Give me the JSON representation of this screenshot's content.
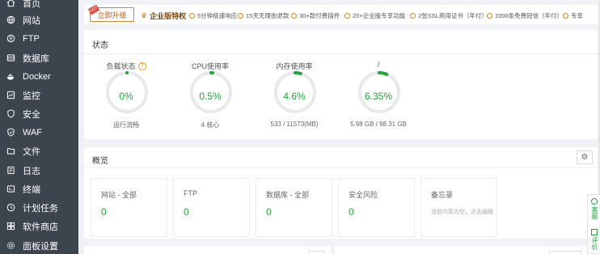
{
  "sidebar": {
    "items": [
      {
        "label": "首页",
        "icon": "home-icon"
      },
      {
        "label": "网站",
        "icon": "globe-icon"
      },
      {
        "label": "FTP",
        "icon": "ftp-icon"
      },
      {
        "label": "数据库",
        "icon": "database-icon"
      },
      {
        "label": "Docker",
        "icon": "docker-icon"
      },
      {
        "label": "监控",
        "icon": "monitor-icon"
      },
      {
        "label": "安全",
        "icon": "shield-icon"
      },
      {
        "label": "WAF",
        "icon": "waf-icon"
      },
      {
        "label": "文件",
        "icon": "folder-icon"
      },
      {
        "label": "日志",
        "icon": "log-icon"
      },
      {
        "label": "终端",
        "icon": "terminal-icon"
      },
      {
        "label": "计划任务",
        "icon": "clock-icon"
      },
      {
        "label": "软件商店",
        "icon": "store-icon"
      },
      {
        "label": "面板设置",
        "icon": "gear-icon"
      }
    ]
  },
  "topbar": {
    "upgrade_label": "立即升级",
    "hot_tag": "HOT",
    "enterprise_title": "企业版特权",
    "features": [
      "5分钟极速响应",
      "15天无理由退款",
      "30+款付费插件",
      "20+企业版专享功能",
      "2张SSL商用证书（年付）",
      "1000条免费短信（年付）",
      "专享"
    ]
  },
  "status": {
    "title": "状态",
    "gauges": [
      {
        "label": "负载状态",
        "value": "0%",
        "sub": "运行流畅",
        "percent": 0,
        "help": "?"
      },
      {
        "label": "CPU使用率",
        "value": "0.5%",
        "sub": "4 核心",
        "percent": 0.5
      },
      {
        "label": "内存使用率",
        "value": "4.6%",
        "sub": "533 / 11573(MB)",
        "percent": 4.6
      },
      {
        "label": "/",
        "value": "6.35%",
        "sub": "5.98 GB / 98.31 GB",
        "percent": 6.35
      }
    ]
  },
  "overview": {
    "title": "概览",
    "boxes": [
      {
        "label": "网站 - 全部",
        "value": "0"
      },
      {
        "label": "FTP",
        "value": "0"
      },
      {
        "label": "数据库 - 全部",
        "value": "0"
      },
      {
        "label": "安全风险",
        "value": "0"
      },
      {
        "label": "备忘录",
        "note": "当前内容为空，点击编辑"
      }
    ]
  },
  "float": {
    "service": "客服",
    "feedback": "评价"
  },
  "colors": {
    "sidebar_bg": "#3c444d",
    "accent": "#20a53a",
    "gauge_track": "#e8e9eb"
  }
}
